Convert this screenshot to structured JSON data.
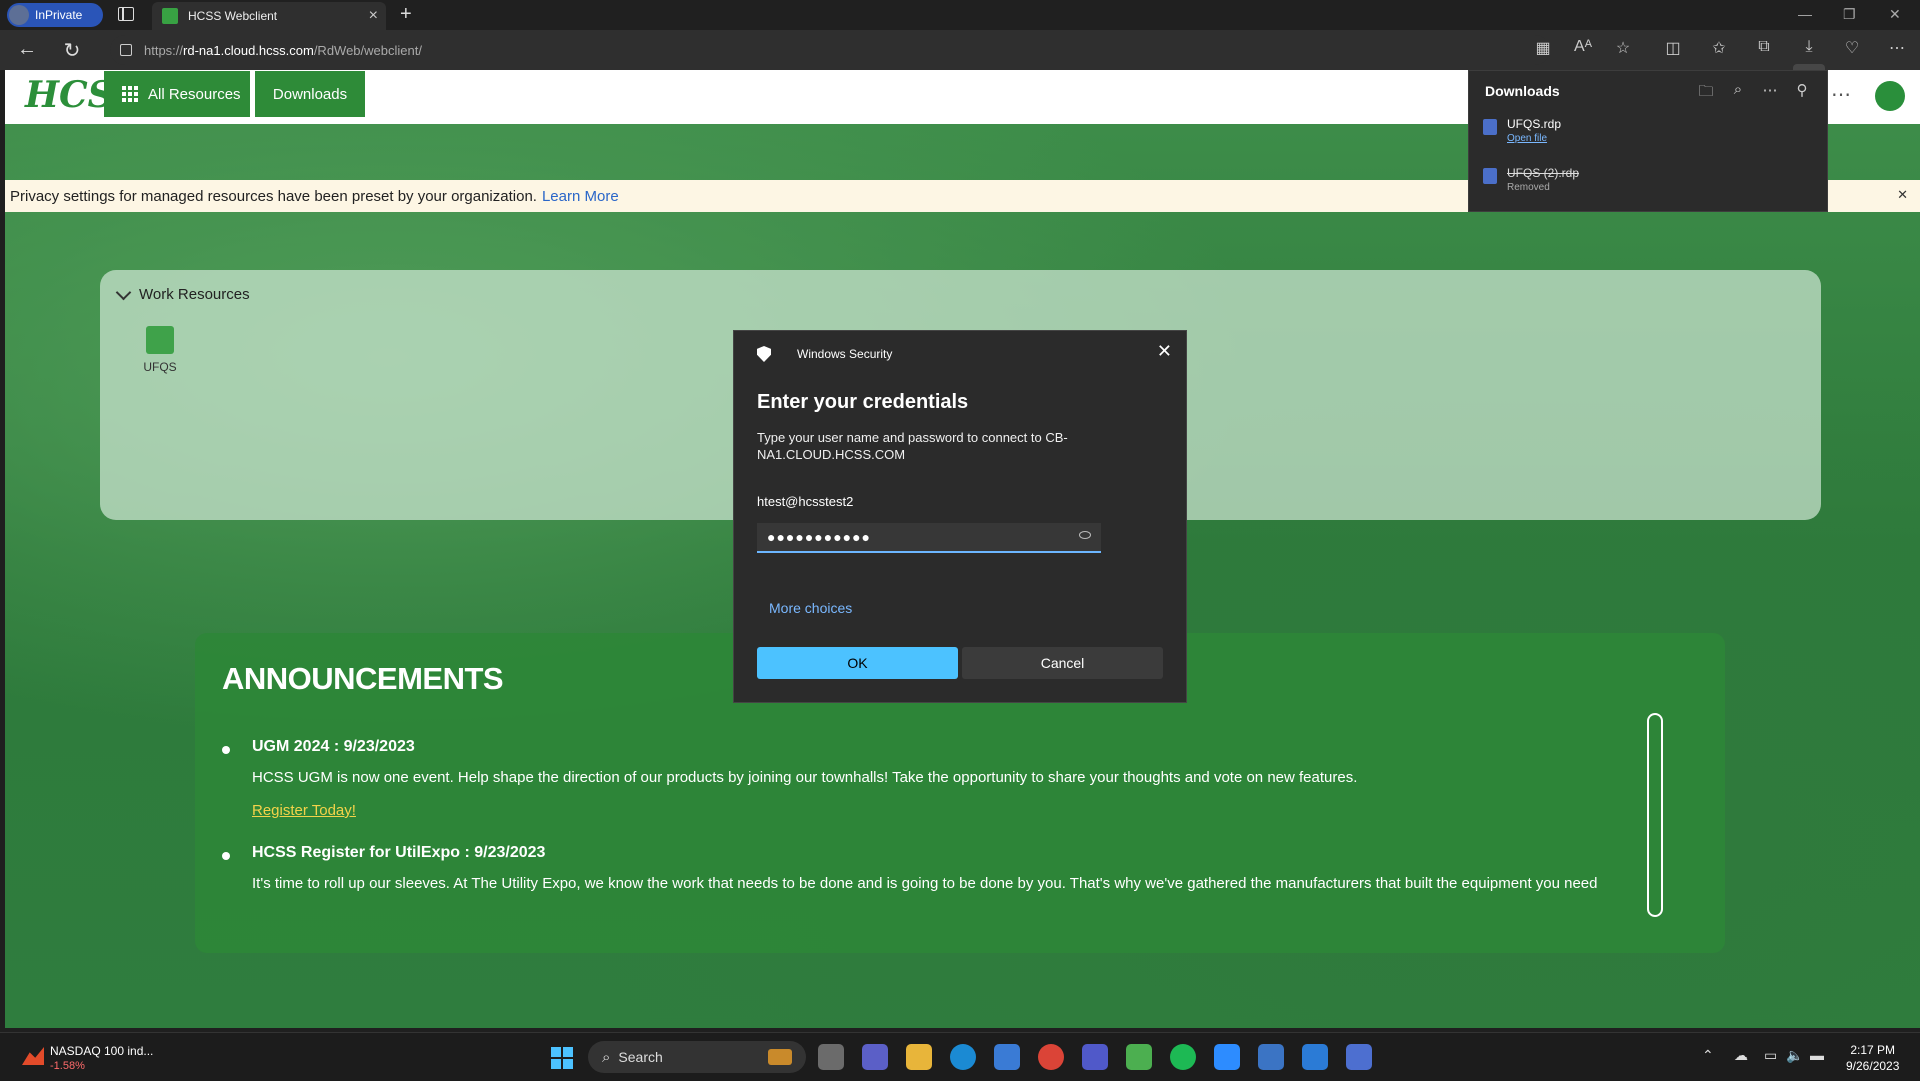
{
  "browser": {
    "inprivate_label": "InPrivate",
    "tab_title": "HCSS Webclient",
    "url_scheme": "https://",
    "url_host": "rd-na1.cloud.hcss.com",
    "url_path": "/RdWeb/webclient/"
  },
  "header": {
    "logo": "HCSS",
    "nav": [
      "All Resources",
      "Downloads"
    ]
  },
  "privacy_bar": {
    "text": "Privacy settings for managed resources have been preset by your organization.",
    "link": "Learn More"
  },
  "work_resources": {
    "title": "Work Resources",
    "items": [
      {
        "label": "UFQS"
      }
    ]
  },
  "announcements": {
    "title": "ANNOUNCEMENTS",
    "items": [
      {
        "heading": "UGM 2024 : 9/23/2023",
        "body": "HCSS UGM is now one event. Help shape the direction of our products by joining our townhalls! Take the opportunity to share your thoughts and vote on new features.",
        "link": "Register Today!"
      },
      {
        "heading": "HCSS Register for UtilExpo : 9/23/2023",
        "body": "It's time to roll up our sleeves. At The Utility Expo, we know the work that needs to be done and is going to be done by you. That's why we've gathered the manufacturers that built the equipment you need"
      }
    ]
  },
  "dialog": {
    "window_title": "Windows Security",
    "heading": "Enter your credentials",
    "message": "Type your user name and password to connect to CB-NA1.CLOUD.HCSS.COM",
    "username": "htest@hcsstest2",
    "password_mask": "●●●●●●●●●●●",
    "more_choices": "More choices",
    "ok": "OK",
    "cancel": "Cancel"
  },
  "downloads_panel": {
    "title": "Downloads",
    "items": [
      {
        "name": "UFQS.rdp",
        "status": "Open file"
      },
      {
        "name": "UFQS (2).rdp",
        "status": "Removed"
      }
    ]
  },
  "taskbar": {
    "stock_name": "NASDAQ 100 ind...",
    "stock_change": "-1.58%",
    "search_label": "Search",
    "time": "2:17 PM",
    "date": "9/26/2023"
  }
}
